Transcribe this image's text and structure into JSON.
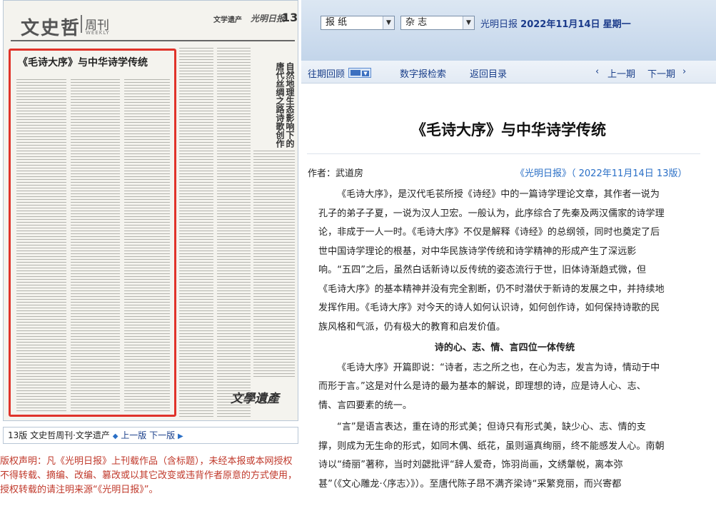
{
  "paper": {
    "masthead": "文史哲",
    "zhoukan": "周刊",
    "weekly": "WEEKLY",
    "section": "文学遗产",
    "logo": "光明日报",
    "page_number": "13",
    "article_title": "《毛诗大序》与中华诗学传统",
    "right_title": "自然地理生态影响下的唐代丝绸之路诗歌创作",
    "bottom_logo": "文學遺產"
  },
  "page_nav": {
    "label": "13版 文史哲周刊·文学遗产",
    "prev": "上一版",
    "next": "下一版",
    "prev_arrow": "◆",
    "next_arrow": "▶"
  },
  "copyright": "版权声明：凡《光明日报》上刊载作品（含标题），未经本报或本网授权不得转载、摘编、改编、篡改或以其它改变或违背作者原意的方式使用，授权转载的请注明来源“《光明日报》”。",
  "topbar": {
    "select_paper": "报  纸",
    "select_mag": "杂  志",
    "dropdown_glyph": "▼",
    "date_text": "光明日报",
    "date_bold": "2022年11月14日",
    "weekday": "星期一"
  },
  "subbar": {
    "archive": "往期回顾",
    "search": "数字报检索",
    "back": "返回目录",
    "prev_issue": "上一期",
    "next_issue": "下一期",
    "left_chevron": "‹",
    "right_chevron": "›"
  },
  "article": {
    "title": "《毛诗大序》与中华诗学传统",
    "author": "作者：武道房",
    "source": "《光明日报》（ 2022年11月14日   13版）",
    "p1_lines": [
      "《毛诗大序》，是汉代毛苌所授《诗经》中的一篇诗学理论文章，其作者一说为",
      "孔子的弟子子夏，一说为汉人卫宏。一般认为，此序综合了先秦及两汉儒家的诗学理",
      "论，非成于一人一时。《毛诗大序》不仅是解释《诗经》的总纲领，同时也奠定了后",
      "世中国诗学理论的根基，对中华民族诗学传统和诗学精神的形成产生了深远影",
      "响。“五四”之后，虽然白话新诗以反传统的姿态流行于世，旧体诗渐趋式微，但",
      "《毛诗大序》的基本精神并没有完全割断，仍不时潜伏于新诗的发展之中，并持续地",
      "发挥作用。《毛诗大序》对今天的诗人如何认识诗，如何创作诗，如何保持诗歌的民",
      "族风格和气派，仍有极大的教育和启发价值。"
    ],
    "subhead": "诗的心、志、情、言四位一体传统",
    "p2_lines": [
      "《毛诗大序》开篇即说：“诗者，志之所之也，在心为志，发言为诗，情动于中",
      "而形于言。”这是对什么是诗的最为基本的解说，即理想的诗，应是诗人心、志、",
      "情、言四要素的统一。"
    ],
    "p3_lines": [
      "“言”是语言表达，重在诗的形式美；但诗只有形式美，缺少心、志、情的支",
      "撑，则成为无生命的形式，如同木偶、纸花，虽则逼真绚丽，终不能感发人心。南朝",
      "诗以“绮丽”著称，当时刘勰批评“辞人爱奇，饰羽尚画，文绣鞶帨，离本弥",
      "甚”（《文心雕龙·〈序志〉》）。至唐代陈子昂不满齐梁诗“采繁竞丽，而兴寄都"
    ]
  }
}
